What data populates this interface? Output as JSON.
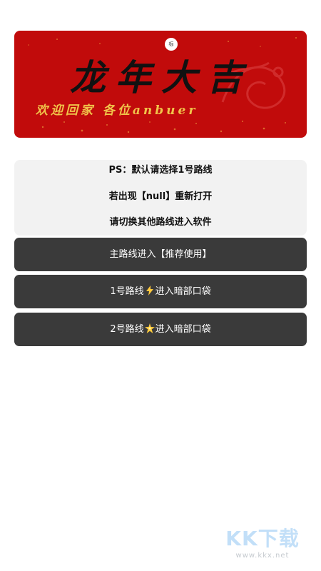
{
  "banner": {
    "badge_text": "标",
    "headline": "龙年大吉",
    "subline": "欢迎回家 各位anbuer",
    "colors": {
      "background": "#c10b0b",
      "headline": "#111111",
      "subline": "#f0c44a"
    },
    "decor_icon": "dragon-icon"
  },
  "notice": {
    "lines": [
      "PS：默认请选择1号路线",
      "若出现【null】重新打开",
      "请切换其他路线进入软件"
    ]
  },
  "buttons": {
    "main": {
      "label": "主路线进入【推荐使用】"
    },
    "route1": {
      "prefix": "1号路线",
      "icon": "lightning-icon",
      "suffix": "进入暗部口袋"
    },
    "route2": {
      "prefix": "2号路线",
      "icon": "sparkle-star-icon",
      "suffix": "进入暗部口袋"
    },
    "colors": {
      "background": "#3a3a3a",
      "text": "#ffffff"
    }
  },
  "watermark": {
    "main": "KK下载",
    "url": "www.kkx.net"
  }
}
